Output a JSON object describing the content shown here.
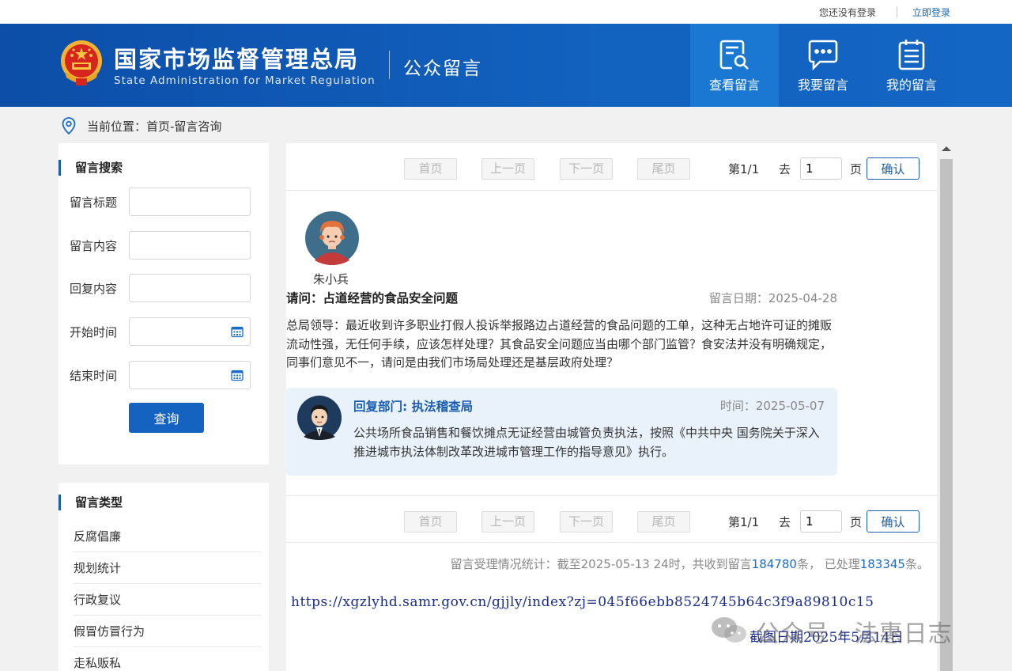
{
  "topbar": {
    "not_logged_in": "您还没有登录",
    "login_link": "立即登录"
  },
  "header": {
    "site_name_cn": "国家市场监督管理总局",
    "site_name_en": "State Administration for Market Regulation",
    "section": "公众留言",
    "nav": [
      {
        "label": "查看留言",
        "icon": "view-messages-icon",
        "active": true
      },
      {
        "label": "我要留言",
        "icon": "chat-bubble-icon",
        "active": false
      },
      {
        "label": "我的留言",
        "icon": "clipboard-list-icon",
        "active": false
      }
    ]
  },
  "breadcrumb": {
    "text": "当前位置：首页-留言咨询"
  },
  "search": {
    "title": "留言搜索",
    "fields": [
      {
        "label": "留言标题",
        "value": ""
      },
      {
        "label": "留言内容",
        "value": ""
      },
      {
        "label": "回复内容",
        "value": ""
      },
      {
        "label": "开始时间",
        "value": ""
      },
      {
        "label": "结束时间",
        "value": ""
      }
    ],
    "button": "查询"
  },
  "types": {
    "title": "留言类型",
    "items": [
      "反腐倡廉",
      "规划统计",
      "行政复议",
      "假冒仿冒行为",
      "走私贩私"
    ]
  },
  "pager": {
    "first": "首页",
    "prev": "上一页",
    "next": "下一页",
    "last": "尾页",
    "page_info": "第1/1",
    "goto_label": "去",
    "page_value": "1",
    "page_unit": "页",
    "confirm": "确认"
  },
  "message": {
    "user": "朱小兵",
    "title": "请问：占道经营的食品安全问题",
    "date": "留言日期：2025-04-28",
    "body": "总局领导：最近收到许多职业打假人投诉举报路边占道经营的食品问题的工单，这种无占地许可证的摊贩流动性强，无任何手续，应该怎样处理？其食品安全问题应当由哪个部门监管？食安法并没有明确规定，同事们意见不一，请问是由我们市场局处理还是基层政府处理？"
  },
  "reply": {
    "dept": "回复部门: 执法稽查局",
    "time": "时间：2025-05-07",
    "body": "公共场所食品销售和餐饮摊点无证经营由城管负责执法，按照《中共中央 国务院关于深入推进城市执法体制改革改进城市管理工作的指导意见》执行。"
  },
  "stats": {
    "prefix": "留言受理情况统计：截至2025-05-13 24时，共收到留言",
    "received": "184780",
    "mid": "条，  已处理",
    "processed": "183345",
    "suffix": "条。"
  },
  "annotation": {
    "url": "https://xgzlyhd.samr.gov.cn/gjjly/index?zj=045f66ebb8524745b64c3f9a89810c15",
    "capture_date": "截图日期2025年5月14日"
  },
  "watermark": {
    "text": "公众号 · 法惠日志"
  },
  "colors": {
    "header_blue": "#0c4ea8",
    "active_nav": "#1a78d2",
    "link_blue": "#1a6cc7",
    "reply_bg": "#e9f1fb"
  }
}
